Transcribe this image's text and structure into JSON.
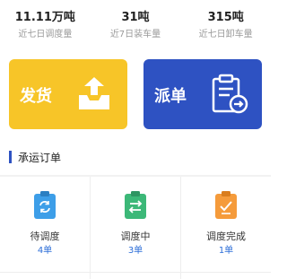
{
  "stats": [
    {
      "value": "11.11万吨",
      "label": "近七日调度量"
    },
    {
      "value": "31吨",
      "label": "近7日装车量"
    },
    {
      "value": "315吨",
      "label": "近七日卸车量"
    }
  ],
  "actions": {
    "ship": {
      "label": "发货",
      "color": "#f7c528",
      "icon": "tray-upload-icon"
    },
    "dispatch": {
      "label": "派单",
      "color": "#2e52c2",
      "icon": "clipboard-arrow-icon"
    }
  },
  "section": {
    "title": "承运订单"
  },
  "order_statuses": [
    {
      "label": "待调度",
      "count": "4单",
      "color": "#3d9ee8",
      "icon": "clipboard-refresh-icon"
    },
    {
      "label": "调度中",
      "count": "3单",
      "color": "#3cb878",
      "icon": "clipboard-transfer-icon"
    },
    {
      "label": "调度完成",
      "count": "1单",
      "color": "#f59b3b",
      "icon": "clipboard-check-icon"
    }
  ]
}
